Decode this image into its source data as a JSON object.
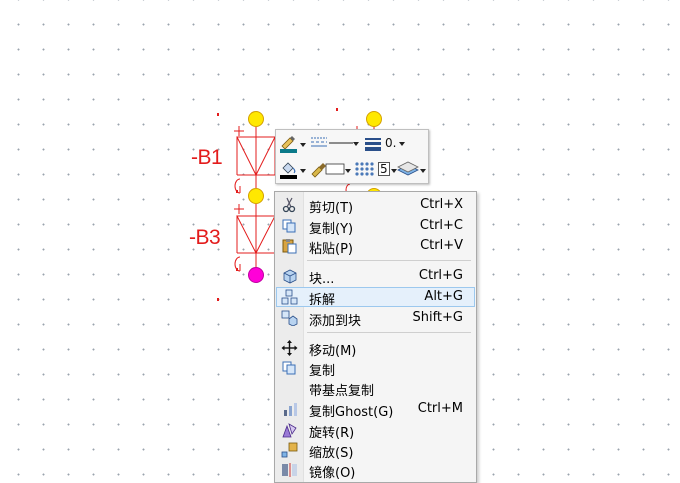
{
  "schematic": {
    "labels": [
      {
        "id": "b1",
        "text": "-B1"
      },
      {
        "id": "b3",
        "text": "-B3"
      }
    ],
    "colors": {
      "wire": "#e31c1c",
      "pin": "#ffe800",
      "pin_outline": "#d4a000",
      "selected_pin": "#ff00d8"
    }
  },
  "toolbar": {
    "line_width_value": "0.",
    "hatch_value": "5",
    "icons": [
      "pen-color-icon",
      "line-style-icon",
      "line-width-icon",
      "fill-bucket-icon",
      "brush-icon",
      "hatch-pattern-icon",
      "layer-icon"
    ]
  },
  "context_menu": {
    "items": [
      {
        "name": "cut",
        "label": "剪切(T)",
        "shortcut": "Ctrl+X",
        "icon": "scissors-icon"
      },
      {
        "name": "copy",
        "label": "复制(Y)",
        "shortcut": "Ctrl+C",
        "icon": "copy-icon"
      },
      {
        "name": "paste",
        "label": "粘贴(P)",
        "shortcut": "Ctrl+V",
        "icon": "paste-icon"
      },
      {
        "name": "block",
        "label": "块...",
        "shortcut": "Ctrl+G",
        "icon": "block-icon"
      },
      {
        "name": "explode",
        "label": "拆解",
        "shortcut": "Alt+G",
        "icon": "explode-icon",
        "highlighted": true
      },
      {
        "name": "add-to-block",
        "label": "添加到块",
        "shortcut": "Shift+G",
        "icon": "add-to-block-icon"
      },
      {
        "name": "move",
        "label": "移动(M)",
        "shortcut": "",
        "icon": "move-icon"
      },
      {
        "name": "duplicate",
        "label": "复制",
        "shortcut": "",
        "icon": "duplicate-icon"
      },
      {
        "name": "copy-with-base",
        "label": "带基点复制",
        "shortcut": "",
        "icon": ""
      },
      {
        "name": "copy-ghost",
        "label": "复制Ghost(G)",
        "shortcut": "Ctrl+M",
        "icon": "ghost-copy-icon"
      },
      {
        "name": "rotate",
        "label": "旋转(R)",
        "shortcut": "",
        "icon": "rotate-icon"
      },
      {
        "name": "scale",
        "label": "缩放(S)",
        "shortcut": "",
        "icon": "scale-icon"
      },
      {
        "name": "mirror",
        "label": "镜像(O)",
        "shortcut": "",
        "icon": "mirror-icon"
      }
    ]
  }
}
